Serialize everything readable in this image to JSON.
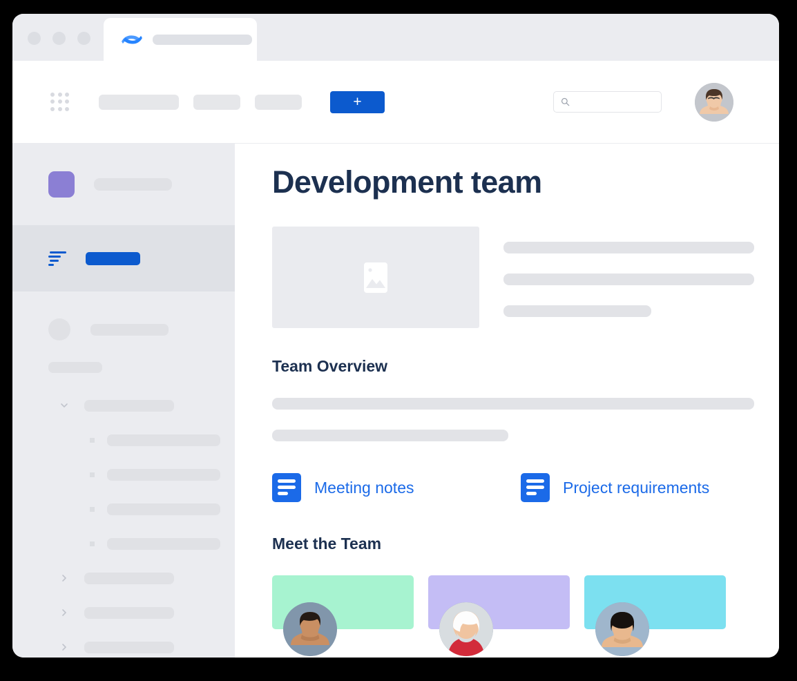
{
  "window": {
    "traffic_lights": [
      "close",
      "minimize",
      "maximize"
    ],
    "tab": {
      "logo_icon": "confluence-logo",
      "title_placeholder": ""
    }
  },
  "top_nav": {
    "app_switcher_icon": "apps-grid-icon",
    "menu_placeholders": [
      "",
      "",
      ""
    ],
    "create_button_label": "+",
    "create_button_color": "#0C5ACE",
    "search": {
      "icon": "search-icon",
      "value": "",
      "placeholder": ""
    },
    "avatar_icon": "user-avatar"
  },
  "sidebar": {
    "background_color": "#EBECF0",
    "space": {
      "icon": "space-avatar-icon",
      "icon_color": "#8B7FD4",
      "name_placeholder": ""
    },
    "selected_item": {
      "icon": "overview-list-icon",
      "label_placeholder": "",
      "highlight_color": "#0C5ACE",
      "row_background": "#DFE1E6"
    },
    "items": [
      {
        "type": "avatar-item",
        "icon": "circle-avatar-icon",
        "label_placeholder": ""
      },
      {
        "type": "short-item",
        "label_placeholder": ""
      },
      {
        "type": "expanded-parent",
        "icon": "chevron-down-icon",
        "label_placeholder": ""
      },
      {
        "type": "child",
        "icon": "bullet-icon",
        "label_placeholder": ""
      },
      {
        "type": "child",
        "icon": "bullet-icon",
        "label_placeholder": ""
      },
      {
        "type": "child",
        "icon": "bullet-icon",
        "label_placeholder": ""
      },
      {
        "type": "child",
        "icon": "bullet-icon",
        "label_placeholder": ""
      },
      {
        "type": "collapsed-parent",
        "icon": "chevron-right-icon",
        "label_placeholder": ""
      },
      {
        "type": "collapsed-parent",
        "icon": "chevron-right-icon",
        "label_placeholder": ""
      },
      {
        "type": "collapsed-parent",
        "icon": "chevron-right-icon",
        "label_placeholder": ""
      }
    ]
  },
  "main": {
    "page_title": "Development team",
    "title_color": "#1C3050",
    "hero": {
      "image_placeholder_icon": "photo-placeholder-icon",
      "text_lines": [
        "",
        "",
        ""
      ]
    },
    "team_overview": {
      "heading": "Team Overview",
      "text_lines": [
        "",
        ""
      ]
    },
    "document_links": [
      {
        "icon": "page-document-icon",
        "label": "Meeting notes",
        "color": "#1B6AE8"
      },
      {
        "icon": "page-document-icon",
        "label": "Project requirements",
        "color": "#1B6AE8"
      }
    ],
    "meet_the_team": {
      "heading": "Meet the Team",
      "members": [
        {
          "banner_color": "#A7F3D0",
          "avatar_icon": "member-avatar-1",
          "name_placeholder": ""
        },
        {
          "banner_color": "#C4BDF5",
          "avatar_icon": "member-avatar-2",
          "name_placeholder": ""
        },
        {
          "banner_color": "#7CE0F0",
          "avatar_icon": "member-avatar-3",
          "name_placeholder": ""
        }
      ]
    }
  }
}
